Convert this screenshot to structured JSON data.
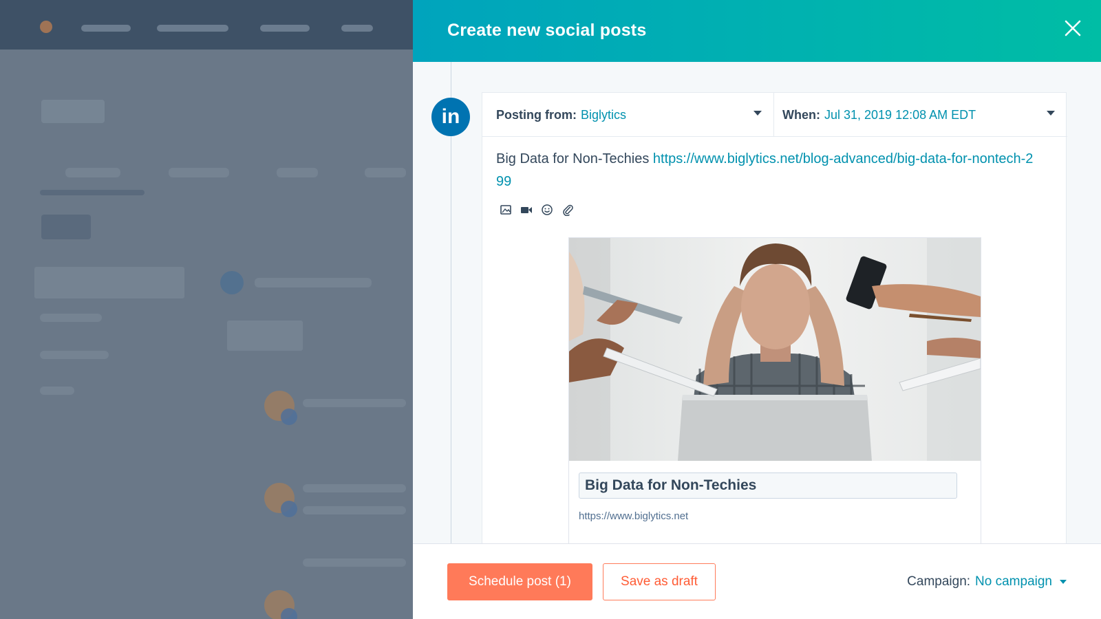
{
  "modal": {
    "title": "Create new social posts",
    "network": "in",
    "posting_from_label": "Posting from:",
    "posting_from_value": "Biglytics",
    "when_label": "When:",
    "when_value": "Jul 31, 2019 12:08 AM EDT",
    "post_text": "Big Data for Non-Techies",
    "post_link": "https://www.biglytics.net/blog-advanced/big-data-for-nontech-299",
    "toolbar_icons": [
      "image-icon",
      "video-icon",
      "emoji-icon",
      "attachment-icon"
    ],
    "preview": {
      "title": "Big Data for Non-Techies",
      "domain": "https://www.biglytics.net"
    },
    "footer": {
      "schedule_label": "Schedule post (1)",
      "draft_label": "Save as draft",
      "campaign_label": "Campaign:",
      "campaign_value": "No campaign"
    }
  },
  "colors": {
    "header_start": "#00a4bd",
    "header_end": "#00bda5",
    "linkedin": "#0073b1",
    "link": "#0091ae",
    "primary_button": "#ff7a59",
    "text": "#33475b"
  }
}
